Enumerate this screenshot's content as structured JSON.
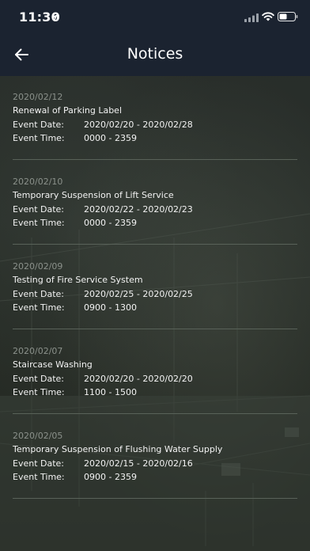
{
  "status_bar": {
    "time": "11:30"
  },
  "header": {
    "title": "Notices",
    "back_icon": "arrow-left-icon"
  },
  "labels": {
    "event_date": "Event Date:",
    "event_time": "Event Time:"
  },
  "notices": [
    {
      "posted": "2020/02/12",
      "title": "Renewal of Parking Label",
      "event_date": "2020/02/20 - 2020/02/28",
      "event_time": "0000 - 2359"
    },
    {
      "posted": "2020/02/10",
      "title": "Temporary Suspension of Lift Service",
      "event_date": "2020/02/22 - 2020/02/23",
      "event_time": "0000 - 2359"
    },
    {
      "posted": "2020/02/09",
      "title": "Testing of Fire Service System",
      "event_date": "2020/02/25 - 2020/02/25",
      "event_time": "0900 - 1300"
    },
    {
      "posted": "2020/02/07",
      "title": "Staircase Washing",
      "event_date": "2020/02/20 - 2020/02/20",
      "event_time": "1100 - 1500"
    },
    {
      "posted": "2020/02/05",
      "title": "Temporary Suspension of Flushing Water Supply",
      "event_date": "2020/02/15 - 2020/02/16",
      "event_time": "0900 - 2359"
    }
  ],
  "colors": {
    "header_bg": "#1b2330",
    "date_text": "#8b918b",
    "text": "#f2f2f2",
    "divider": "#596259"
  }
}
